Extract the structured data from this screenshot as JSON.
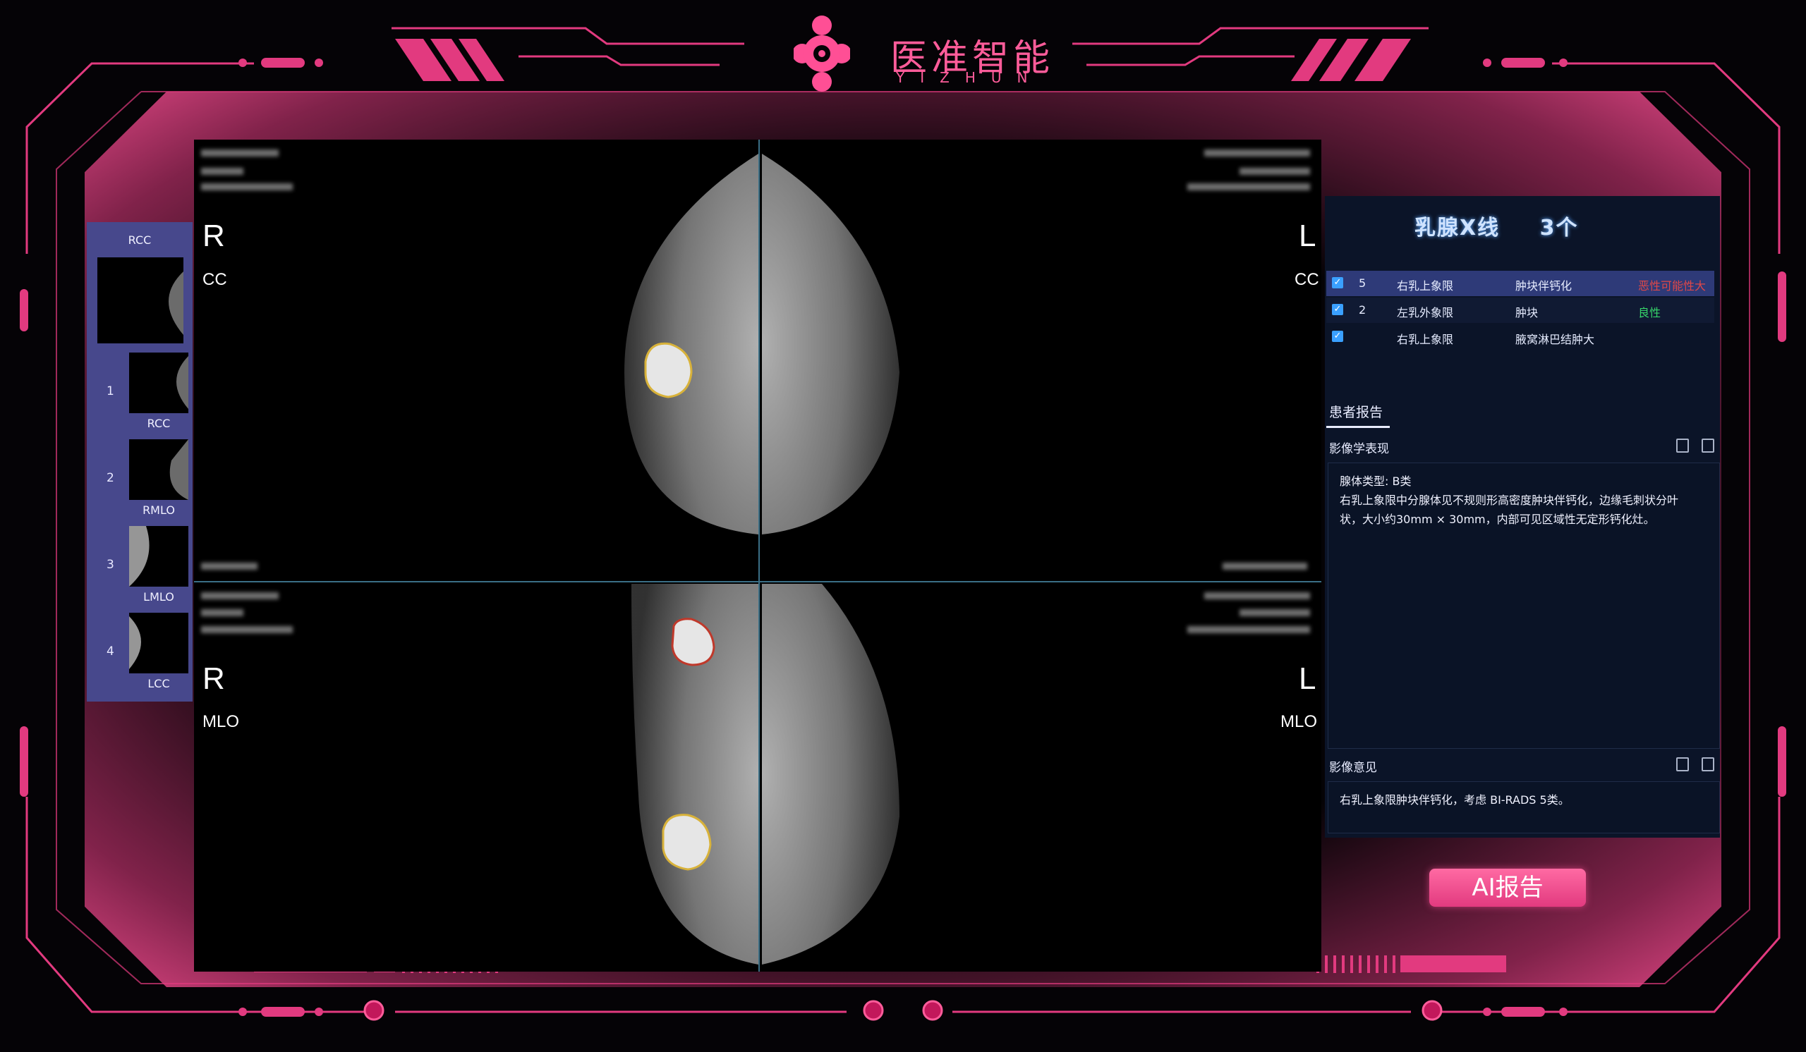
{
  "brand": {
    "name_cn": "医准智能",
    "name_en": "YIZHUN",
    "accent": "#e23a7f"
  },
  "sidebar": {
    "top_label": "RCC",
    "items": [
      {
        "num": "1",
        "label": "RCC"
      },
      {
        "num": "2",
        "label": "RMLO"
      },
      {
        "num": "3",
        "label": "LMLO"
      },
      {
        "num": "4",
        "label": "LCC"
      }
    ]
  },
  "viewer": {
    "quadrants": [
      {
        "lat": "R",
        "view": "CC"
      },
      {
        "lat": "L",
        "view": "CC"
      },
      {
        "lat": "R",
        "view": "MLO"
      },
      {
        "lat": "L",
        "view": "MLO"
      }
    ]
  },
  "panel": {
    "title": "乳腺X线",
    "count": "3个",
    "findings": [
      {
        "checked": true,
        "num": "5",
        "location": "右乳上象限",
        "type": "肿块伴钙化",
        "result": "恶性可能性大",
        "result_color": "#e04848"
      },
      {
        "checked": true,
        "num": "2",
        "location": "左乳外象限",
        "type": "肿块",
        "result": "良性",
        "result_color": "#36d46a"
      },
      {
        "checked": true,
        "num": "",
        "location": "右乳上象限",
        "type": "腋窝淋巴结肿大",
        "result": "",
        "result_color": ""
      }
    ],
    "report_tab": "患者报告",
    "imaging_label": "影像学表现",
    "imaging_text_1": "腺体类型: B类",
    "imaging_text_2": "右乳上象限中分腺体见不规则形高密度肿块伴钙化，边缘毛刺状分叶",
    "imaging_text_3": "状，大小约30mm × 30mm，内部可见区域性无定形钙化灶。",
    "opinion_label": "影像意见",
    "opinion_text": "右乳上象限肿块伴钙化，考虑 BI-RADS 5类。",
    "ai_button": "AI报告"
  }
}
